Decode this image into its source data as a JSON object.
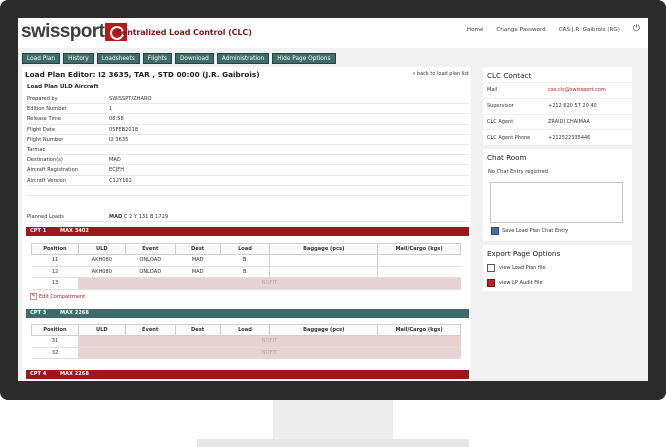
{
  "header": {
    "brand": "swissport",
    "tagline": "Centralized Load Control (CLC)",
    "links": [
      "Home",
      "Change Password",
      "CAS:J.R. Gaibrois (RG)"
    ],
    "power_icon": "power-icon"
  },
  "nav": [
    "Load Plan",
    "History",
    "Loadsheets",
    "Flights",
    "Download",
    "Administration",
    "Hide Page Options"
  ],
  "editor": {
    "title": "Load Plan Editor: I2 3635, TAR , STD 00:00 (J.R. Gaibrois)",
    "back_link": "« back to load plan list",
    "subtitle": "Load Plan ULD Aircraft"
  },
  "info_rows": [
    {
      "k": "Prepared by",
      "v": "SWISSPT/ZHARO"
    },
    {
      "k": "Edition Number",
      "v": "1"
    },
    {
      "k": "Release Time",
      "v": "08:58"
    },
    {
      "k": "Flight Date",
      "v": "05FEB2018"
    },
    {
      "k": "Flight Number",
      "v": "I2 3635"
    },
    {
      "k": "Tarmac",
      "v": ""
    },
    {
      "k": "Destination(s)",
      "v": "MAD"
    },
    {
      "k": "Aircraft Registration",
      "v": "ECJFH"
    },
    {
      "k": "Aircraft Version",
      "v": "C12Y162"
    },
    {
      "k": "",
      "v": ""
    }
  ],
  "planned": {
    "k": "Planned Loads",
    "v_bold": "MAD",
    "v": " C 2 Y 131 B 1729"
  },
  "columns": [
    "Position",
    "ULD",
    "Event",
    "Dest",
    "Load",
    "Baggage (pcs)",
    "Mail/Cargo (kgs)"
  ],
  "compartments": [
    {
      "name": "CPT 1",
      "max": "MAX 3402",
      "color": "#9b1818",
      "rows": [
        {
          "position": "11",
          "uld": "AKH080",
          "event": "ONLOAD",
          "dest": "MAD",
          "load": "B"
        },
        {
          "position": "12",
          "uld": "AKH080",
          "event": "ONLOAD",
          "dest": "MAD",
          "load": "B"
        },
        {
          "position": "13",
          "nofit": "NOFIT"
        }
      ]
    },
    {
      "name": "CPT 3",
      "max": "MAX 2268",
      "color": "#3e6a69",
      "rows": [
        {
          "position": "31",
          "nofit": "NOFIT"
        },
        {
          "position": "32",
          "nofit": "NOFIT"
        }
      ]
    },
    {
      "name": "CPT 4",
      "max": "MAX 2268",
      "color": "#9b1818",
      "rows": []
    }
  ],
  "edit_compartment": "Edit Compartment",
  "clc_contact": {
    "title": "CLC Contact",
    "rows": [
      {
        "k": "Mail",
        "v": "cas.clc@swissport.com"
      },
      {
        "k": "Supervisor",
        "v": "+212 620 57 20 40"
      },
      {
        "k": "CLC Agent",
        "v": "ZRAIDI CHAIMAA"
      },
      {
        "k": "CLC Agent Phone",
        "v": "+212522335446"
      }
    ]
  },
  "chat": {
    "title": "Chat Room",
    "empty": "No Chat Entry registred",
    "save": "Save Load Plan Chat Entry"
  },
  "export": {
    "title": "Export Page Options",
    "items": [
      "view Load Plan file",
      "view LP Audit File"
    ]
  }
}
